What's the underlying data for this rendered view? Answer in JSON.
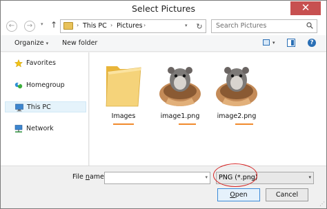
{
  "window": {
    "title": "Select Pictures",
    "close_glyph": "✕"
  },
  "nav": {
    "back_glyph": "←",
    "forward_glyph": "→",
    "dropdown_glyph": "▾",
    "up_glyph": "↑",
    "breadcrumbs": [
      "This PC",
      "Pictures"
    ],
    "crumb_sep": "›",
    "refresh_glyph": "↻",
    "search_placeholder": "Search Pictures"
  },
  "toolbar": {
    "organize_label": "Organize",
    "caret": "▾",
    "new_folder_label": "New folder",
    "view_caret": "▾",
    "help_glyph": "?"
  },
  "sidebar": {
    "items": [
      {
        "label": "Favorites",
        "icon": "star-icon"
      },
      {
        "label": "Homegroup",
        "icon": "homegroup-icon"
      },
      {
        "label": "This PC",
        "icon": "computer-icon",
        "selected": true
      },
      {
        "label": "Network",
        "icon": "network-icon"
      }
    ]
  },
  "files": [
    {
      "name": "Images",
      "type": "folder",
      "icon": "folder-icon"
    },
    {
      "name": "image1.png",
      "type": "image",
      "icon": "hamster-thumbnail"
    },
    {
      "name": "image2.png",
      "type": "image",
      "icon": "hamster-thumbnail"
    }
  ],
  "bottom": {
    "file_name_label_pre": "File ",
    "file_name_label_accel": "n",
    "file_name_label_post": "ame:",
    "file_name_value": "",
    "filter_value": "PNG (*.png)",
    "open_accel": "O",
    "open_rest": "pen",
    "cancel_label": "Cancel",
    "caret": "▾",
    "grip_glyph": "⋰"
  },
  "colors": {
    "underline": "#f08a2c",
    "annotation": "#d42222",
    "accent": "#2a6fb5",
    "close": "#c75050"
  }
}
